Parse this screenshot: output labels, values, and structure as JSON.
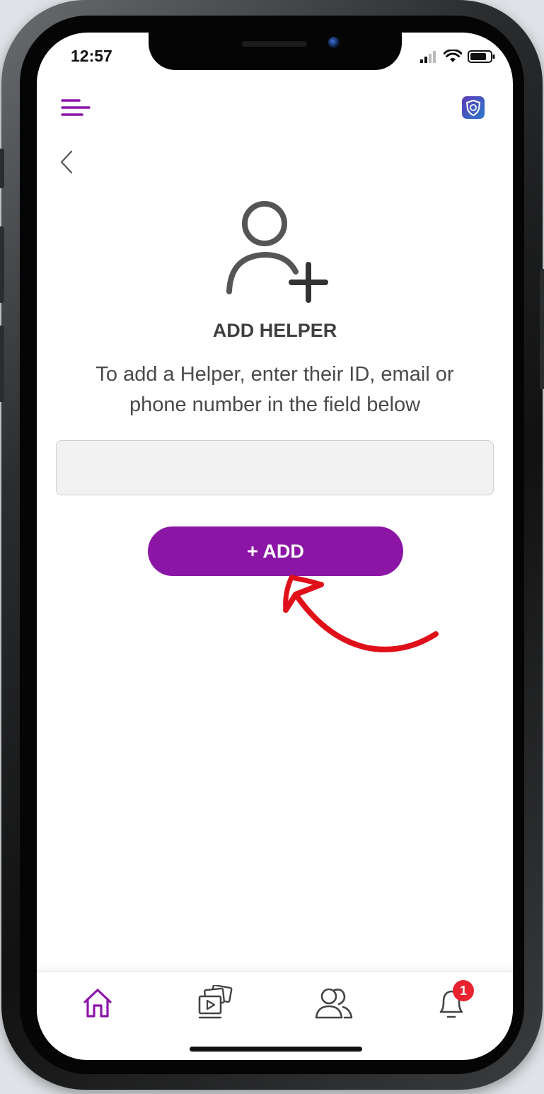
{
  "status_bar": {
    "time": "12:57"
  },
  "header": {
    "menu_icon": "hamburger-menu-icon",
    "app_icon": "shield-badge-icon",
    "back_icon": "chevron-left-icon"
  },
  "main": {
    "hero_icon": "add-user-icon",
    "title": "ADD HELPER",
    "subtitle": "To add a Helper, enter their ID, email or phone number in the field below",
    "input_value": "",
    "input_placeholder": "",
    "add_button_label": "+ ADD",
    "annotation": "red-curved-arrow-icon"
  },
  "bottom_nav": {
    "items": [
      {
        "icon": "home-icon",
        "active": true
      },
      {
        "icon": "media-gallery-icon",
        "active": false
      },
      {
        "icon": "people-icon",
        "active": false
      },
      {
        "icon": "bell-icon",
        "active": false,
        "badge": "1"
      }
    ]
  },
  "colors": {
    "accent": "#8b16a6",
    "active_icon": "#8b16a6",
    "badge": "#e8232f",
    "annotation_arrow": "#e0101a"
  }
}
